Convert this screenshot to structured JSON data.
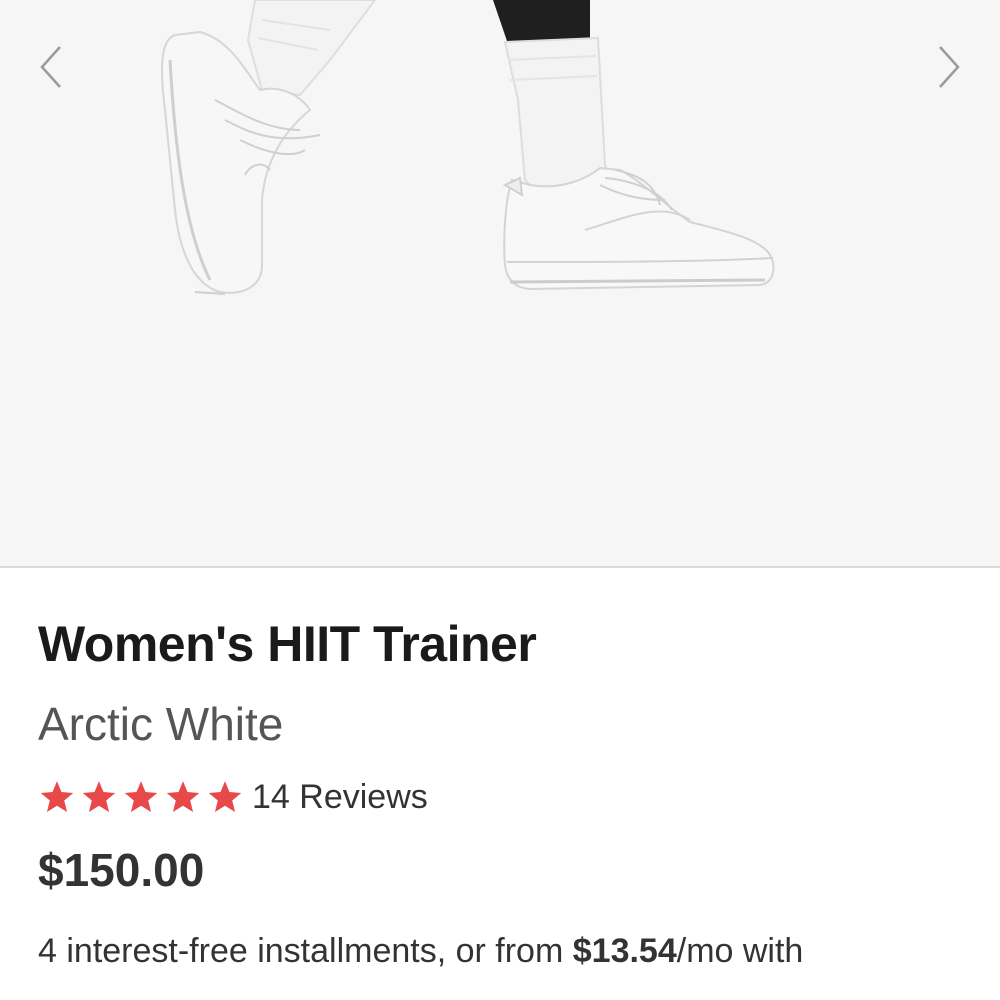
{
  "gallery": {
    "prev_icon": "chevron-left-icon",
    "next_icon": "chevron-right-icon",
    "image_alt": "Women's HIIT Trainer in Arctic White shown on feet with white socks"
  },
  "product": {
    "title": "Women's HIIT Trainer",
    "color": "Arctic White",
    "rating": {
      "stars": 5,
      "max": 5,
      "reviews_label": "14 Reviews",
      "star_color": "#e8484a"
    },
    "price": "$150.00",
    "installments": {
      "prefix": "4 interest-free installments, or from ",
      "amount": "$13.54",
      "suffix": "/mo with"
    }
  }
}
